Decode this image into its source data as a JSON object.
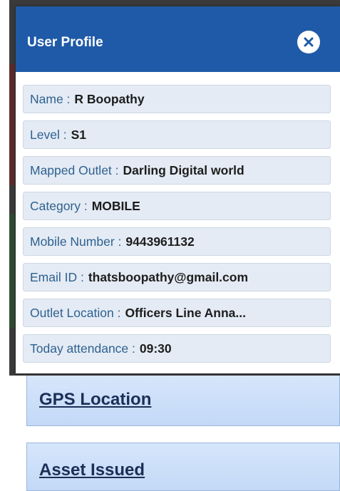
{
  "dialog": {
    "title": "User Profile",
    "close_icon": "close-circle-icon",
    "header_color": "#1f5aa8",
    "rows": [
      {
        "label": "Name :",
        "value": "R Boopathy"
      },
      {
        "label": "Level :",
        "value": "S1"
      },
      {
        "label": "Mapped Outlet :",
        "value": "Darling Digital world"
      },
      {
        "label": "Category :",
        "value": "MOBILE"
      },
      {
        "label": "Mobile Number :",
        "value": "9443961132"
      },
      {
        "label": "Email ID :",
        "value": "thatsboopathy@gmail.com"
      },
      {
        "label": "Outlet Location :",
        "value": "Officers Line  Anna..."
      },
      {
        "label": "Today attendance :",
        "value": "09:30"
      }
    ]
  },
  "sections": {
    "gps_title": "GPS Location",
    "asset_title": "Asset Issued"
  }
}
